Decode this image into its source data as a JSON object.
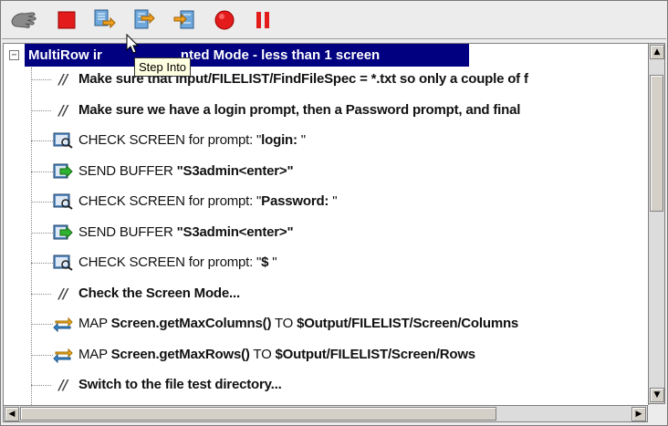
{
  "toolbar": {
    "buttons": [
      {
        "name": "hand-icon",
        "tooltip": ""
      },
      {
        "name": "stop-icon",
        "tooltip": ""
      },
      {
        "name": "step-into-icon",
        "tooltip": "Step Into"
      },
      {
        "name": "step-over-icon",
        "tooltip": ""
      },
      {
        "name": "step-out-icon",
        "tooltip": ""
      },
      {
        "name": "record-icon",
        "tooltip": ""
      },
      {
        "name": "pause-icon",
        "tooltip": ""
      }
    ],
    "tooltip_text": "Step Into"
  },
  "tree": {
    "root_label": "MultiRow in Unformatted Mode - less than 1 screen",
    "root_visible_prefix": "MultiRow ir",
    "root_visible_suffix": "nted Mode - less than 1 screen",
    "collapse_glyph": "−",
    "items": [
      {
        "type": "comment",
        "prefix": "",
        "bold": "Make sure that Input/FILELIST/FindFileSpec = *.txt so only a couple of f",
        "mid": "",
        "tail": ""
      },
      {
        "type": "comment",
        "prefix": "",
        "bold": "Make sure we have a login prompt, then a Password prompt, and final",
        "mid": "",
        "tail": ""
      },
      {
        "type": "check",
        "prefix": "CHECK SCREEN for prompt: \"",
        "bold": "login: ",
        "mid": "\"",
        "tail": ""
      },
      {
        "type": "send",
        "prefix": "SEND BUFFER ",
        "bold": "\"S3admin<enter>\"",
        "mid": "",
        "tail": ""
      },
      {
        "type": "check",
        "prefix": "CHECK SCREEN for prompt: \"",
        "bold": "Password: ",
        "mid": "\"",
        "tail": ""
      },
      {
        "type": "send",
        "prefix": "SEND BUFFER ",
        "bold": "\"S3admin<enter>\"",
        "mid": "",
        "tail": ""
      },
      {
        "type": "check",
        "prefix": "CHECK SCREEN for prompt: \"",
        "bold": "$ ",
        "mid": "\"",
        "tail": ""
      },
      {
        "type": "comment",
        "prefix": "",
        "bold": "Check the Screen Mode...",
        "mid": "",
        "tail": ""
      },
      {
        "type": "map",
        "prefix": "MAP ",
        "bold": "Screen.getMaxColumns()",
        "mid": " TO ",
        "tail": "$Output/FILELIST/Screen/Columns"
      },
      {
        "type": "map",
        "prefix": "MAP ",
        "bold": "Screen.getMaxRows()",
        "mid": " TO ",
        "tail": "$Output/FILELIST/Screen/Rows"
      },
      {
        "type": "comment",
        "prefix": "",
        "bold": "Switch to the file test directory...",
        "mid": "",
        "tail": ""
      }
    ]
  },
  "scrollbars": {
    "up_arrow": "▲",
    "down_arrow": "▼",
    "left_arrow": "◀",
    "right_arrow": "▶"
  },
  "colors": {
    "selection": "#000080",
    "tooltip_bg": "#ffffe1"
  }
}
